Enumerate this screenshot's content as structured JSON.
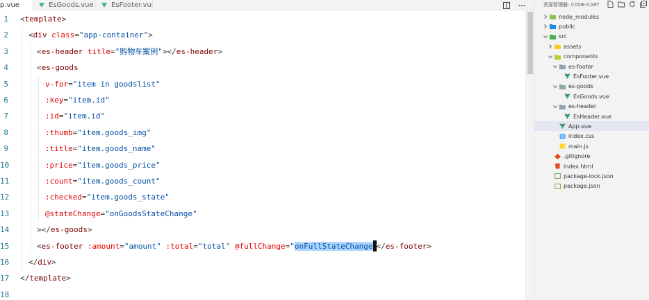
{
  "tabs": [
    {
      "label": "App.vue",
      "shown": "p.vue",
      "active": true
    },
    {
      "label": "EsGoods.vue",
      "active": false
    },
    {
      "label": "EsFooter.vue",
      "active": false
    }
  ],
  "tab_actions": [
    "split-editor-icon",
    "more-actions-icon"
  ],
  "code_lines": [
    {
      "n": "1",
      "indent": 0,
      "tokens": [
        [
          "pun",
          "<"
        ],
        [
          "tag",
          "template"
        ],
        [
          "pun",
          ">"
        ]
      ]
    },
    {
      "n": "2",
      "indent": 1,
      "tokens": [
        [
          "pun",
          "<"
        ],
        [
          "tag",
          "div"
        ],
        [
          "pun",
          " "
        ],
        [
          "attr",
          "class"
        ],
        [
          "pun",
          "="
        ],
        [
          "str",
          "\"app-container\""
        ],
        [
          "pun",
          ">"
        ]
      ]
    },
    {
      "n": "3",
      "indent": 2,
      "tokens": [
        [
          "pun",
          "<"
        ],
        [
          "tag",
          "es-header"
        ],
        [
          "pun",
          " "
        ],
        [
          "attr",
          "title"
        ],
        [
          "pun",
          "="
        ],
        [
          "str",
          "\"购物车案例\""
        ],
        [
          "pun",
          "></"
        ],
        [
          "tag",
          "es-header"
        ],
        [
          "pun",
          ">"
        ]
      ]
    },
    {
      "n": "4",
      "indent": 2,
      "tokens": [
        [
          "pun",
          "<"
        ],
        [
          "tag",
          "es-goods"
        ]
      ]
    },
    {
      "n": "5",
      "indent": 3,
      "tokens": [
        [
          "attr",
          "v-for"
        ],
        [
          "pun",
          "="
        ],
        [
          "str",
          "\"item in goodslist\""
        ]
      ]
    },
    {
      "n": "6",
      "indent": 3,
      "tokens": [
        [
          "attr",
          ":key"
        ],
        [
          "pun",
          "="
        ],
        [
          "str",
          "\"item.id\""
        ]
      ]
    },
    {
      "n": "7",
      "indent": 3,
      "tokens": [
        [
          "attr",
          ":id"
        ],
        [
          "pun",
          "="
        ],
        [
          "str",
          "\"item.id\""
        ]
      ]
    },
    {
      "n": "8",
      "indent": 3,
      "tokens": [
        [
          "attr",
          ":thumb"
        ],
        [
          "pun",
          "="
        ],
        [
          "str",
          "\"item.goods_img\""
        ]
      ]
    },
    {
      "n": "9",
      "indent": 3,
      "tokens": [
        [
          "attr",
          ":title"
        ],
        [
          "pun",
          "="
        ],
        [
          "str",
          "\"item.goods_name\""
        ]
      ]
    },
    {
      "n": "10",
      "indent": 3,
      "tokens": [
        [
          "attr",
          ":price"
        ],
        [
          "pun",
          "="
        ],
        [
          "str",
          "\"item.goods_price\""
        ]
      ]
    },
    {
      "n": "11",
      "indent": 3,
      "tokens": [
        [
          "attr",
          ":count"
        ],
        [
          "pun",
          "="
        ],
        [
          "str",
          "\"item.goods_count\""
        ]
      ]
    },
    {
      "n": "12",
      "indent": 3,
      "tokens": [
        [
          "attr",
          ":checked"
        ],
        [
          "pun",
          "="
        ],
        [
          "str",
          "\"item.goods_state\""
        ]
      ]
    },
    {
      "n": "13",
      "indent": 3,
      "tokens": [
        [
          "attr",
          "@stateChange"
        ],
        [
          "pun",
          "="
        ],
        [
          "str",
          "\"onGoodsStateChange\""
        ]
      ]
    },
    {
      "n": "14",
      "indent": 2,
      "tokens": [
        [
          "pun",
          "></"
        ],
        [
          "tag",
          "es-goods"
        ],
        [
          "pun",
          ">"
        ]
      ]
    },
    {
      "n": "15",
      "indent": 2,
      "tokens": [
        [
          "pun",
          "<"
        ],
        [
          "tag",
          "es-footer"
        ],
        [
          "pun",
          " "
        ],
        [
          "attr",
          ":amount"
        ],
        [
          "pun",
          "="
        ],
        [
          "str",
          "\"amount\""
        ],
        [
          "pun",
          " "
        ],
        [
          "attr",
          ":total"
        ],
        [
          "pun",
          "="
        ],
        [
          "str",
          "\"total\""
        ],
        [
          "pun",
          " "
        ],
        [
          "attr",
          "@fullChange"
        ],
        [
          "pun",
          "="
        ],
        [
          "str",
          "\""
        ],
        [
          "sel",
          "onFullStateChange"
        ],
        [
          "caret",
          ""
        ],
        [
          "pun",
          "</"
        ],
        [
          "tag",
          "es-footer"
        ],
        [
          "pun",
          ">"
        ]
      ]
    },
    {
      "n": "16",
      "indent": 1,
      "tokens": [
        [
          "pun",
          "</"
        ],
        [
          "tag",
          "div"
        ],
        [
          "pun",
          ">"
        ]
      ]
    },
    {
      "n": "17",
      "indent": 0,
      "tokens": [
        [
          "pun",
          "</"
        ],
        [
          "tag",
          "template"
        ],
        [
          "pun",
          ">"
        ]
      ]
    },
    {
      "n": "18",
      "indent": 0,
      "tokens": []
    }
  ],
  "explorer": {
    "title": "资源管理器: CODE-CART",
    "actions": [
      "new-file-icon",
      "new-folder-icon",
      "refresh-icon",
      "collapse-all-icon"
    ],
    "items": [
      {
        "label": "node_modules",
        "depth": 0,
        "kind": "folder",
        "chevron": "right",
        "color": "#8bc34a"
      },
      {
        "label": "public",
        "depth": 0,
        "kind": "folder",
        "chevron": "right",
        "color": "#1e88e5"
      },
      {
        "label": "src",
        "depth": 0,
        "kind": "folder",
        "chevron": "down",
        "color": "#4caf50"
      },
      {
        "label": "assets",
        "depth": 1,
        "kind": "folder",
        "chevron": "right",
        "color": "#ffca28"
      },
      {
        "label": "components",
        "depth": 1,
        "kind": "folder",
        "chevron": "down",
        "color": "#c0ca33"
      },
      {
        "label": "es-footer",
        "depth": 2,
        "kind": "folder",
        "chevron": "down",
        "color": "#90a4ae"
      },
      {
        "label": "EsFooter.vue",
        "depth": 3,
        "kind": "vue",
        "chevron": "",
        "color": "#41b883"
      },
      {
        "label": "es-goods",
        "depth": 2,
        "kind": "folder",
        "chevron": "down",
        "color": "#90a4ae"
      },
      {
        "label": "EsGoods.vue",
        "depth": 3,
        "kind": "vue",
        "chevron": "",
        "color": "#41b883"
      },
      {
        "label": "es-header",
        "depth": 2,
        "kind": "folder",
        "chevron": "down",
        "color": "#90a4ae"
      },
      {
        "label": "EsHeader.vue",
        "depth": 3,
        "kind": "vue",
        "chevron": "",
        "color": "#41b883"
      },
      {
        "label": "App.vue",
        "depth": 2,
        "kind": "vue",
        "chevron": "",
        "color": "#41b883",
        "selected": true
      },
      {
        "label": "index.css",
        "depth": 2,
        "kind": "css",
        "chevron": "",
        "color": "#42a5f5"
      },
      {
        "label": "main.js",
        "depth": 2,
        "kind": "js",
        "chevron": "",
        "color": "#fdd835"
      },
      {
        "label": ".gitignore",
        "depth": 1,
        "kind": "git",
        "chevron": "",
        "color": "#e64a19"
      },
      {
        "label": "index.html",
        "depth": 1,
        "kind": "html",
        "chevron": "",
        "color": "#e44d26"
      },
      {
        "label": "package-lock.json",
        "depth": 1,
        "kind": "npm",
        "chevron": "",
        "color": "#7cb342"
      },
      {
        "label": "package.json",
        "depth": 1,
        "kind": "npm",
        "chevron": "",
        "color": "#7cb342"
      }
    ]
  }
}
